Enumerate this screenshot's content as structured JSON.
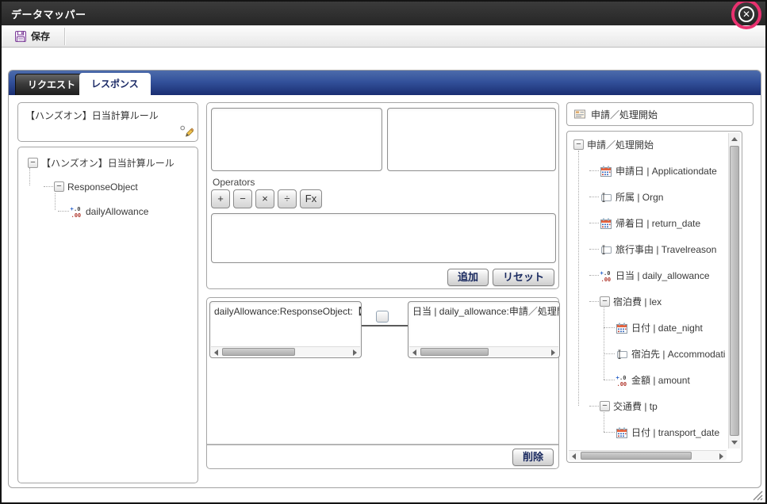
{
  "window": {
    "title": "データマッパー",
    "close_glyph": "✕"
  },
  "toolbar": {
    "save_label": "保存"
  },
  "tabs": {
    "request": "リクエスト",
    "response": "レスポンス"
  },
  "left_panel": {
    "rule_name": "【ハンズオン】日当計算ルール",
    "tree": [
      {
        "label": "【ハンズオン】日当計算ルール",
        "icon": "collapse-toggle",
        "level": 0
      },
      {
        "label": "ResponseObject",
        "icon": "collapse-toggle",
        "level": 1
      },
      {
        "label": "dailyAllowance",
        "icon": "number-field",
        "level": 2
      }
    ]
  },
  "expression_panel": {
    "operators_label": "Operators",
    "operators": [
      "+",
      "−",
      "×",
      "÷",
      "Fx"
    ],
    "add_label": "追加",
    "reset_label": "リセット"
  },
  "mapping_panel": {
    "source_value": "dailyAllowance:ResponseObject:【",
    "target_value": "日当 | daily_allowance:申請／処理開",
    "delete_label": "削除"
  },
  "right_panel": {
    "header": "申請／処理開始",
    "tree": [
      {
        "label": "申請／処理開始",
        "icon": "collapse-toggle",
        "level": 0
      },
      {
        "label": "申請日 | Applicationdate",
        "icon": "calendar",
        "level": 1
      },
      {
        "label": "所属 | Orgn",
        "icon": "text-field",
        "level": 1
      },
      {
        "label": "帰着日 | return_date",
        "icon": "calendar",
        "level": 1
      },
      {
        "label": "旅行事由 | Travelreason",
        "icon": "text-field",
        "level": 1
      },
      {
        "label": "日当 | daily_allowance",
        "icon": "number-field",
        "level": 1
      },
      {
        "label": "宿泊費 | lex",
        "icon": "collapse-toggle",
        "level": 1
      },
      {
        "label": "日付 | date_night",
        "icon": "calendar",
        "level": 2
      },
      {
        "label": "宿泊先 | Accommodati",
        "icon": "text-field",
        "level": 2
      },
      {
        "label": "金額 | amount",
        "icon": "number-field",
        "level": 2
      },
      {
        "label": "交通費 | tp",
        "icon": "collapse-toggle",
        "level": 1
      },
      {
        "label": "日付 | transport_date",
        "icon": "calendar",
        "level": 2
      }
    ]
  },
  "icons": {
    "close": "x-in-circle",
    "save": "purple-floppy-disk",
    "edit": "pencil",
    "collapse-toggle": "minus-box",
    "calendar": "date-grid",
    "text-field": "i-beam-box",
    "number-field": "decimal-digits",
    "form": "form-sheet"
  },
  "colors": {
    "titlebar": "#2b2b2b",
    "tabbar_blue_top": "#4d6cab",
    "tabbar_blue_bottom": "#1a2e72",
    "annotation_pink": "#e8316f",
    "save_icon_purple": "#7d3f98",
    "button_text_navy": "#1a2a60"
  }
}
